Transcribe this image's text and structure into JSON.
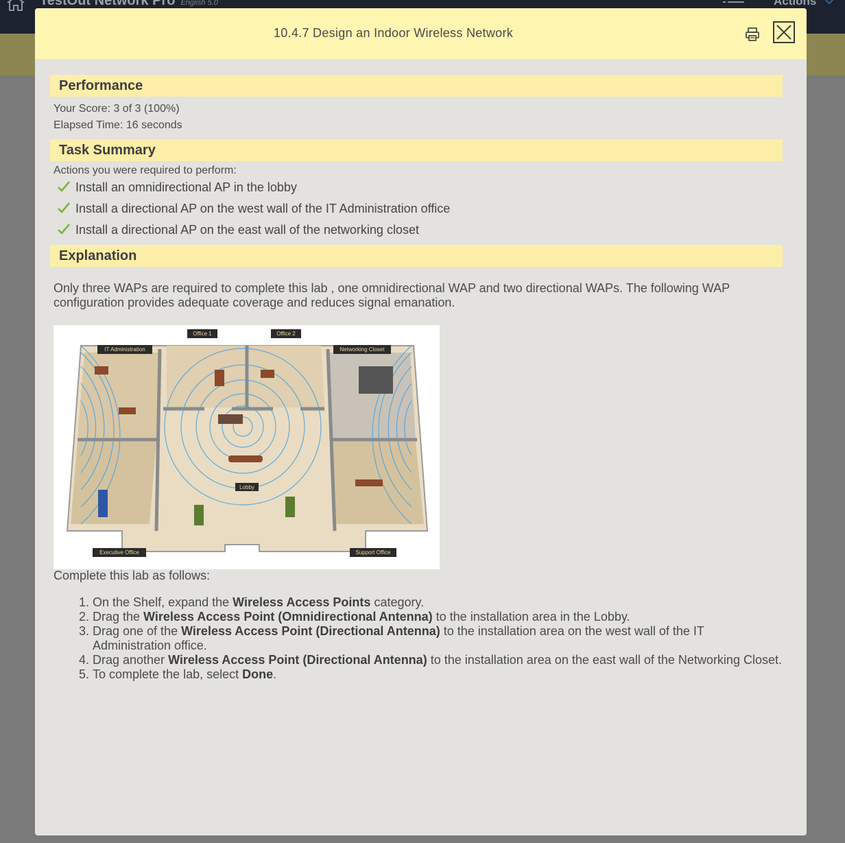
{
  "app": {
    "title": "TestOut Network Pro",
    "edition": "English 5.0",
    "actions_label": "Actions"
  },
  "modal": {
    "title": "10.4.7 Design an Indoor Wireless Network",
    "print_icon": "printer-icon",
    "close_icon": "close-icon"
  },
  "performance": {
    "heading": "Performance",
    "score": "Your Score: 3 of 3 (100%)",
    "elapsed": "Elapsed Time: 16 seconds"
  },
  "task_summary": {
    "heading": "Task Summary",
    "intro": "Actions you were required to perform:",
    "items": [
      "Install an omnidirectional AP in the lobby",
      "Install a directional AP on the west wall of the IT Administration office",
      "Install a directional AP on the east wall of the networking closet"
    ]
  },
  "explanation": {
    "heading": "Explanation",
    "paragraph": "Only three WAPs are required to complete this lab , one omnidirectional WAP and two directional WAPs. The following WAP configuration provides adequate coverage and reduces signal emanation.",
    "diagram_labels": {
      "it_admin": "IT Administration",
      "office1": "Office 1",
      "office2": "Office 2",
      "networking_closet": "Networking Closet",
      "lobby": "Lobby",
      "executive_office": "Executive Office",
      "support_office": "Support Office"
    },
    "steps_intro": "Complete this lab as follows:",
    "steps": [
      {
        "pre": "On the Shelf, expand the ",
        "bold": "Wireless Access Points",
        "post": " category."
      },
      {
        "pre": "Drag the ",
        "bold": "Wireless Access Point (Omnidirectional Antenna)",
        "post": " to the installation area in the Lobby."
      },
      {
        "pre": "Drag one of the ",
        "bold": "Wireless Access Point (Directional Antenna)",
        "post": " to the installation area on the west wall of the IT Administration office."
      },
      {
        "pre": "Drag another ",
        "bold": "Wireless Access Point (Directional Antenna)",
        "post": " to the installation area on the east wall of the Networking Closet."
      },
      {
        "pre": "To complete the lab, select ",
        "bold": "Done",
        "post": "."
      }
    ]
  },
  "colors": {
    "header_bg": "#fef6b1",
    "section_bg": "#fdeea8",
    "check_green": "#7cb342",
    "modal_bg": "#e3e2df"
  }
}
